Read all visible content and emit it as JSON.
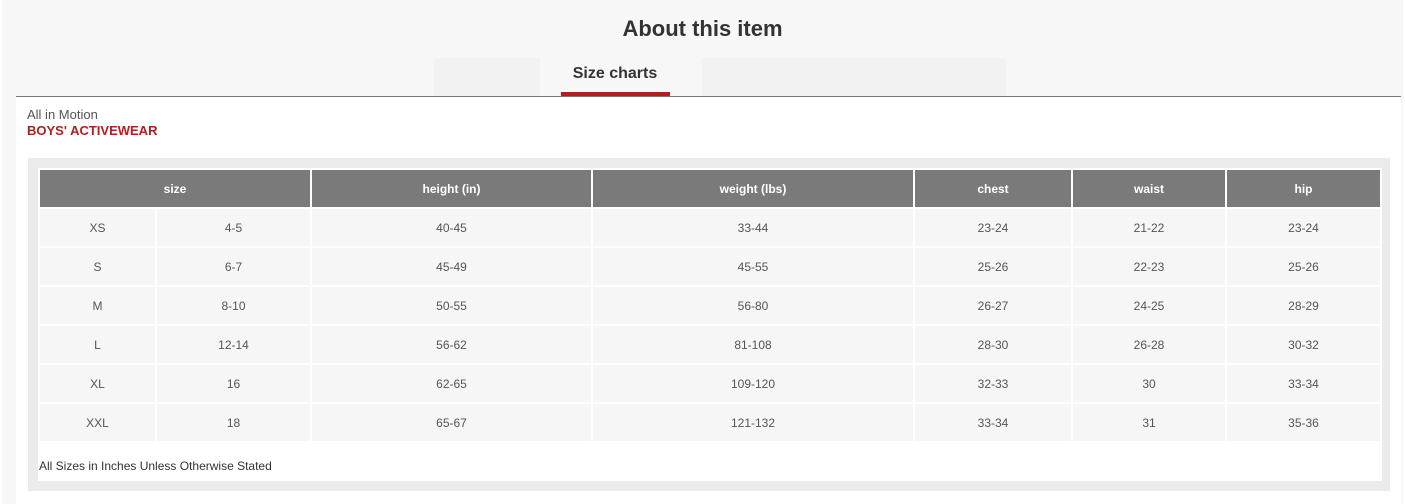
{
  "header": {
    "title": "About this item"
  },
  "tabs": [
    {
      "label": "Size charts",
      "active": true
    }
  ],
  "chart": {
    "brand": "All in Motion",
    "category": "BOYS' ACTIVEWEAR",
    "columns": [
      "size",
      "height (in)",
      "weight (lbs)",
      "chest",
      "waist",
      "hip"
    ],
    "rows": [
      [
        "XS",
        "4-5",
        "40-45",
        "33-44",
        "23-24",
        "21-22",
        "23-24"
      ],
      [
        "S",
        "6-7",
        "45-49",
        "45-55",
        "25-26",
        "22-23",
        "25-26"
      ],
      [
        "M",
        "8-10",
        "50-55",
        "56-80",
        "26-27",
        "24-25",
        "28-29"
      ],
      [
        "L",
        "12-14",
        "56-62",
        "81-108",
        "28-30",
        "26-28",
        "30-32"
      ],
      [
        "XL",
        "16",
        "62-65",
        "109-120",
        "32-33",
        "30",
        "33-34"
      ],
      [
        "XXL",
        "18",
        "65-67",
        "121-132",
        "33-34",
        "31",
        "35-36"
      ]
    ],
    "note": "All Sizes in Inches Unless Otherwise Stated"
  },
  "colors": {
    "accent": "#b01e1e",
    "header_cell": "#7a7a7a",
    "body_cell": "#f6f6f6"
  }
}
